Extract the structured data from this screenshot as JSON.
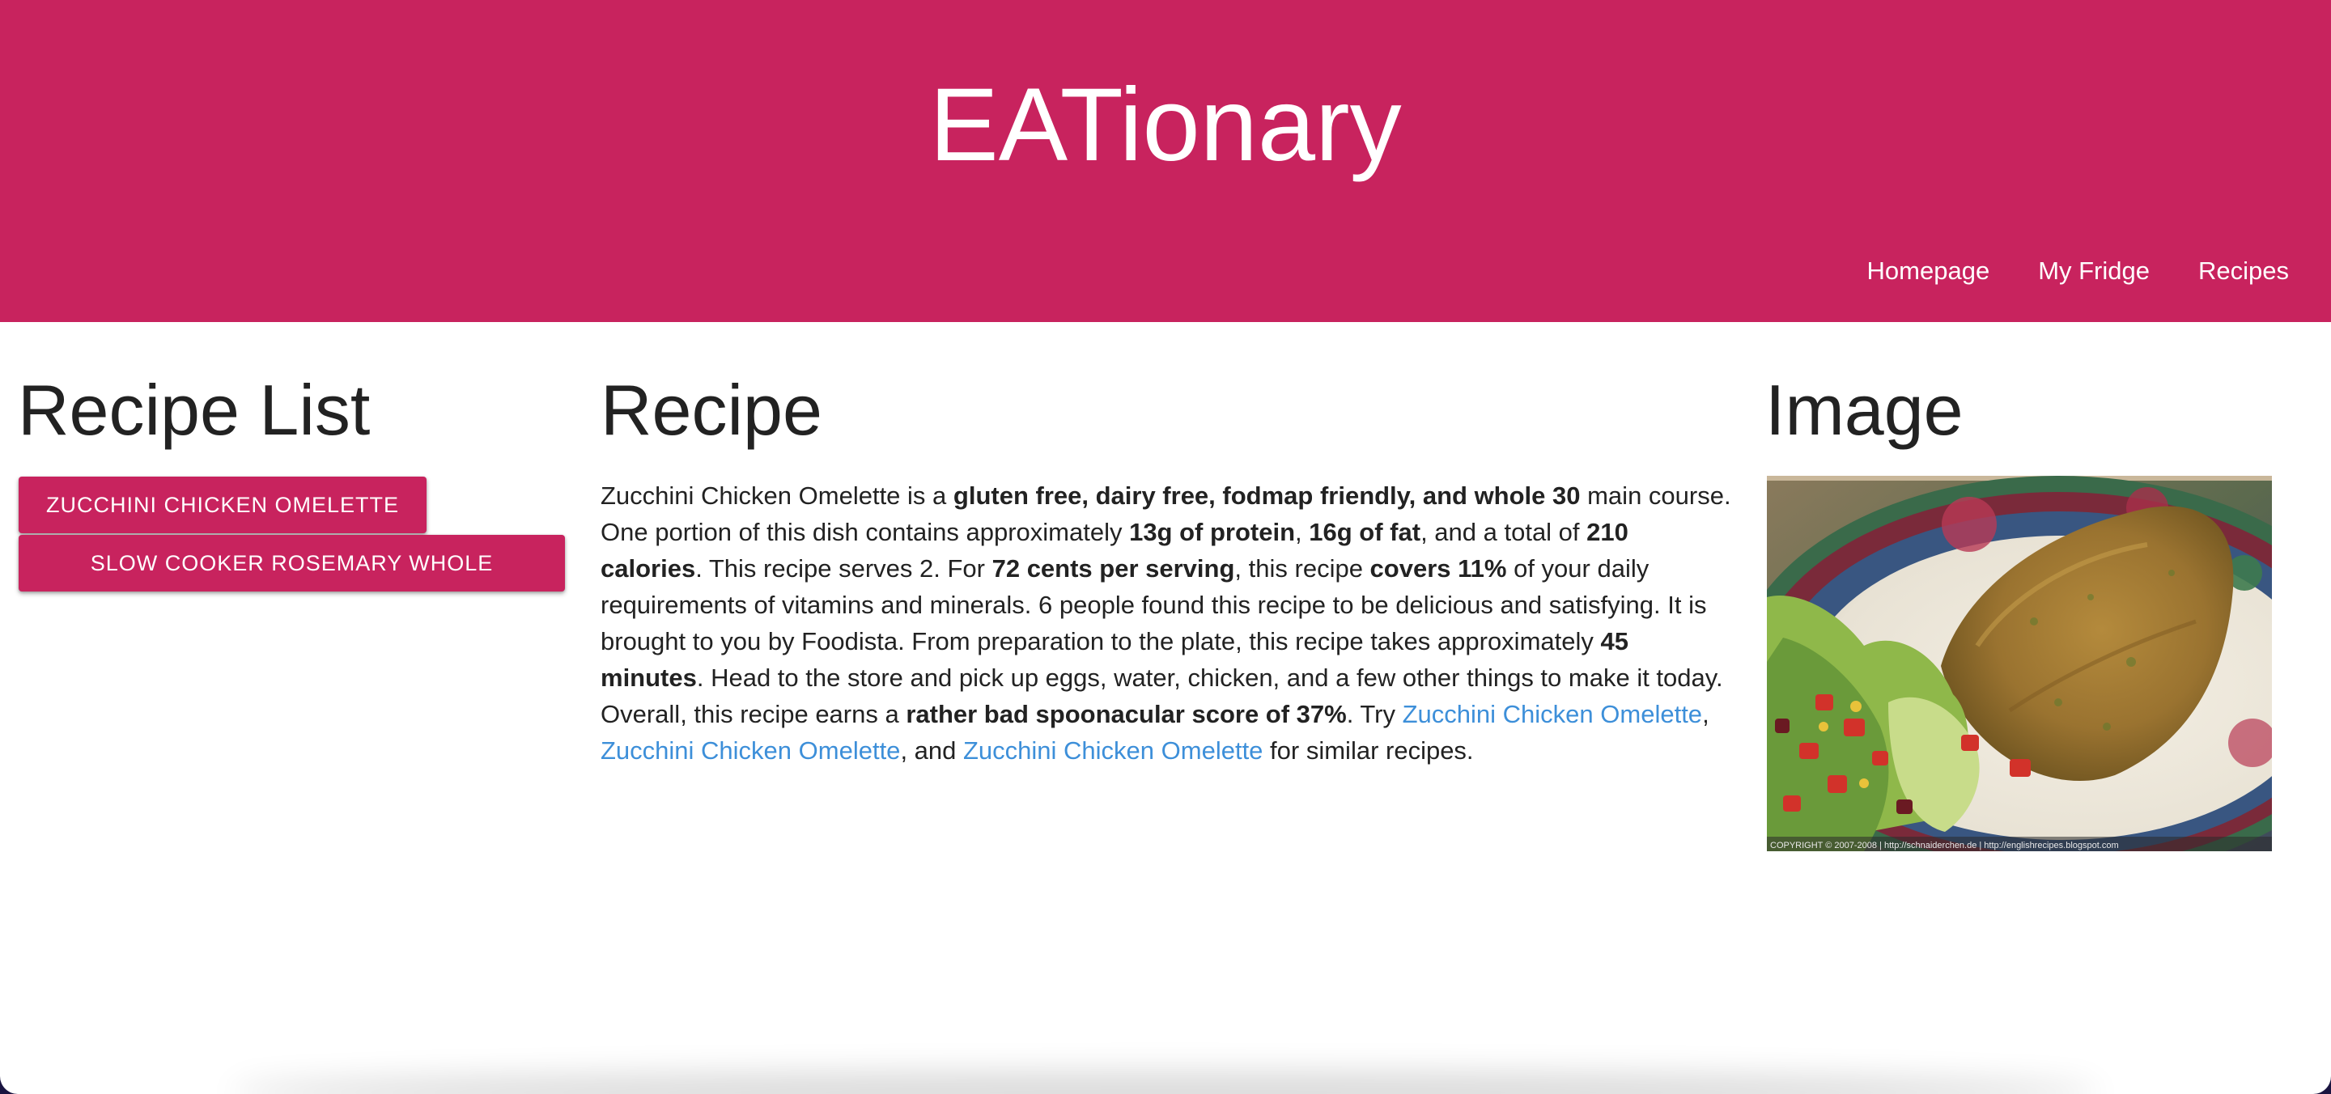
{
  "header": {
    "title": "EATionary",
    "nav": [
      "Homepage",
      "My Fridge",
      "Recipes"
    ]
  },
  "recipe_list": {
    "title": "Recipe List",
    "items": [
      "ZUCCHINI CHICKEN OMELETTE",
      "SLOW COOKER ROSEMARY WHOLE"
    ]
  },
  "recipe": {
    "title": "Recipe",
    "segments": [
      {
        "text": "Zucchini Chicken Omelette is a ",
        "bold": false
      },
      {
        "text": "gluten free, dairy free, fodmap friendly, and whole 30",
        "bold": true
      },
      {
        "text": " main course. One portion of this dish contains approximately ",
        "bold": false
      },
      {
        "text": "13g of protein",
        "bold": true
      },
      {
        "text": ", ",
        "bold": false
      },
      {
        "text": "16g of fat",
        "bold": true
      },
      {
        "text": ", and a total of ",
        "bold": false
      },
      {
        "text": "210 calories",
        "bold": true
      },
      {
        "text": ". This recipe serves 2. For ",
        "bold": false
      },
      {
        "text": "72 cents per serving",
        "bold": true
      },
      {
        "text": ", this recipe ",
        "bold": false
      },
      {
        "text": "covers 11%",
        "bold": true
      },
      {
        "text": " of your daily requirements of vitamins and minerals. 6 people found this recipe to be delicious and satisfying. It is brought to you by Foodista. From preparation to the plate, this recipe takes approximately ",
        "bold": false
      },
      {
        "text": "45 minutes",
        "bold": true
      },
      {
        "text": ". Head to the store and pick up eggs, water, chicken, and a few other things to make it today. Overall, this recipe earns a ",
        "bold": false
      },
      {
        "text": "rather bad spoonacular score of 37%",
        "bold": true
      },
      {
        "text": ". Try ",
        "bold": false
      },
      {
        "text": "Zucchini Chicken Omelette",
        "link": true
      },
      {
        "text": ", ",
        "bold": false
      },
      {
        "text": "Zucchini Chicken Omelette",
        "link": true
      },
      {
        "text": ", and ",
        "bold": false
      },
      {
        "text": "Zucchini Chicken Omelette",
        "link": true
      },
      {
        "text": " for similar recipes.",
        "bold": false
      }
    ]
  },
  "image_panel": {
    "title": "Image",
    "photo_caption": "COPYRIGHT © 2007-2008 | http://schnaiderchen.de | http://englishrecipes.blogspot.com"
  },
  "colors": {
    "brand": "#c8235e",
    "link": "#3d8fd9",
    "text": "#222222"
  }
}
